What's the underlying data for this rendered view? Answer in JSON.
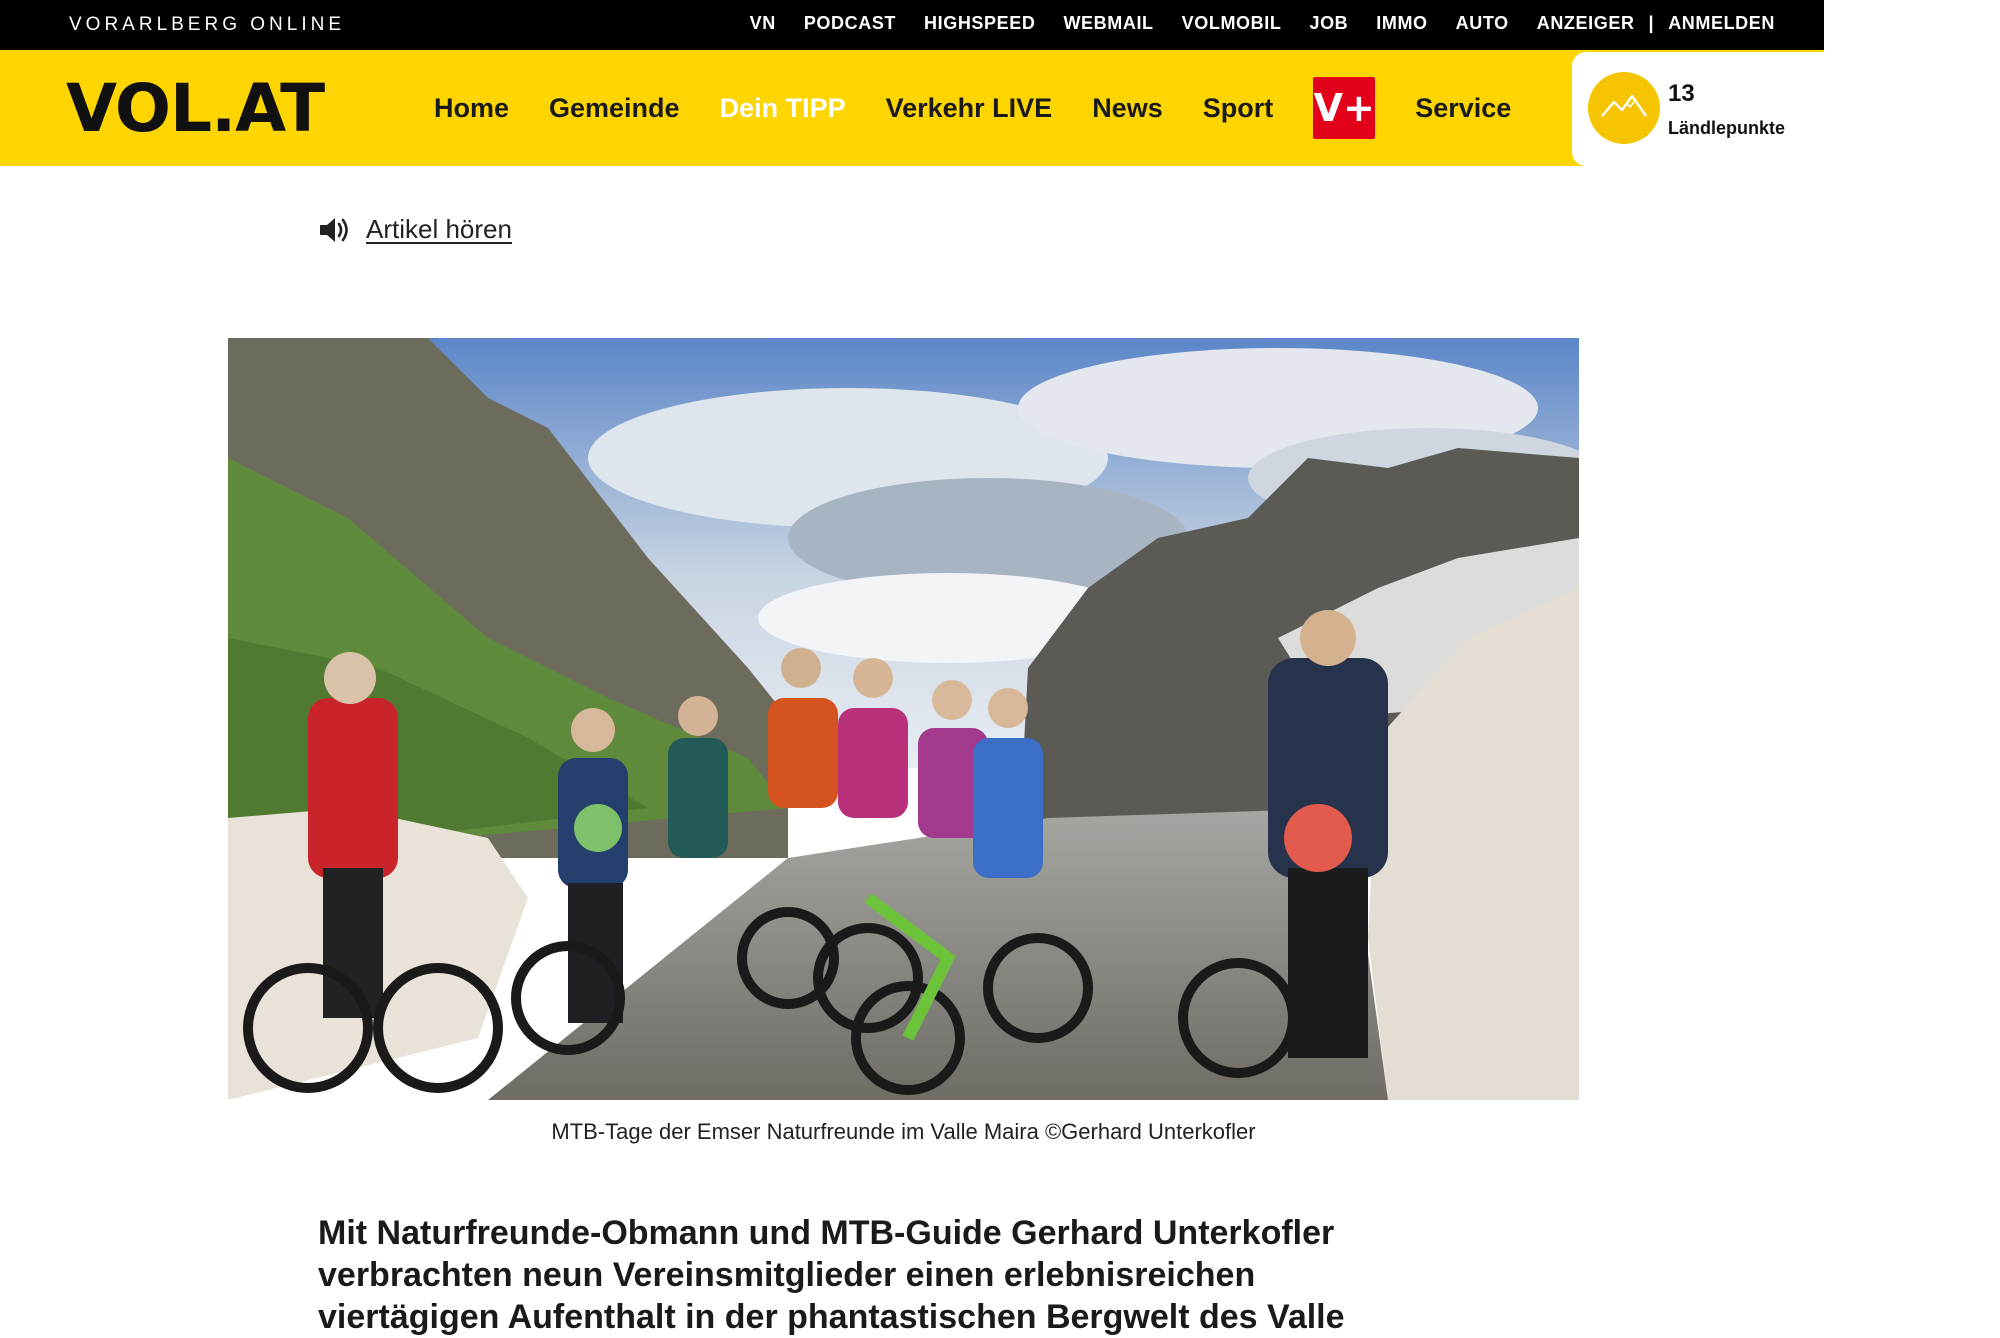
{
  "topbar": {
    "brand": "VORARLBERG ONLINE",
    "links": [
      "VN",
      "PODCAST",
      "HIGHSPEED",
      "WEBMAIL",
      "VOLMOBIL",
      "JOB",
      "IMMO",
      "AUTO",
      "ANZEIGER"
    ],
    "separator": "|",
    "login": "ANMELDEN"
  },
  "navbar": {
    "logo": "VOL.AT",
    "items": [
      "Home",
      "Gemeinde",
      "Dein TIPP",
      "Verkehr LIVE",
      "News",
      "Sport"
    ],
    "vplus_label": "V+",
    "service": "Service",
    "colors": {
      "bar": "#ffd500",
      "tipp_text": "#ffffff",
      "vplus_bg": "#e3001b"
    }
  },
  "points": {
    "count": "13",
    "label": "Ländlepunkte",
    "icon": "mountain-icon"
  },
  "article": {
    "listen_label": "Artikel hören",
    "listen_icon": "speaker-icon",
    "image_caption": "MTB-Tage der Emser Naturfreunde im Valle Maira ©Gerhard Unterkofler",
    "lead_lines": [
      "Mit Naturfreunde-Obmann und MTB-Guide Gerhard Unterkofler",
      "verbrachten neun Vereinsmitglieder einen erlebnisreichen",
      "viertägigen Aufenthalt in der phantastischen Bergwelt des Valle"
    ]
  }
}
